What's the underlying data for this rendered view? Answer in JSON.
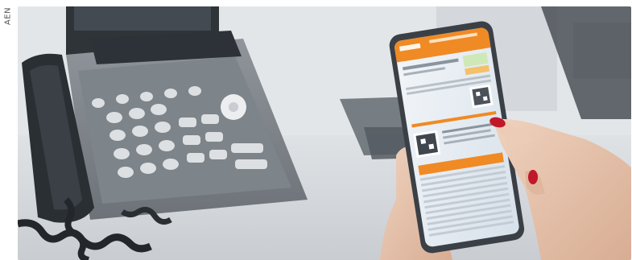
{
  "credit": {
    "text": "AEN"
  },
  "photo": {
    "subject": "hands-holding-smartphone-with-document",
    "colors": {
      "background": "#d9dde1",
      "desk": "#d3d6d9",
      "phone_body": "#3b4047",
      "phone_screen": "#e8eef4",
      "screen_header": "#f08a24",
      "nail_polish": "#c0182a",
      "skin": "#e7c4ad"
    }
  }
}
